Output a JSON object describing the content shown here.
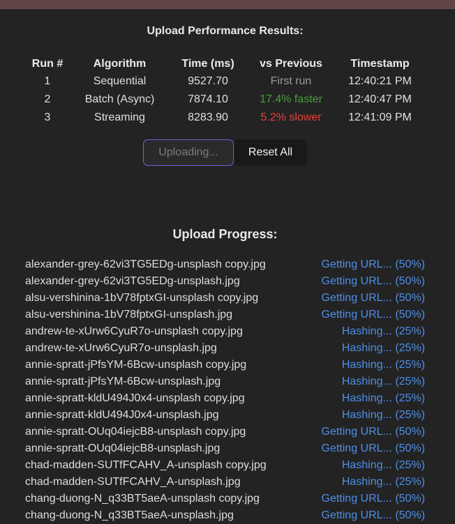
{
  "results": {
    "title": "Upload Performance Results:",
    "headers": [
      "Run #",
      "Algorithm",
      "Time (ms)",
      "vs Previous",
      "Timestamp"
    ],
    "rows": [
      {
        "run": "1",
        "algorithm": "Sequential",
        "time": "9527.70",
        "vs_previous": "First run",
        "timestamp": "12:40:21 PM"
      },
      {
        "run": "2",
        "algorithm": "Batch (Async)",
        "time": "7874.10",
        "vs_previous": "17.4% faster",
        "timestamp": "12:40:47 PM"
      },
      {
        "run": "3",
        "algorithm": "Streaming",
        "time": "8283.90",
        "vs_previous": "5.2% slower",
        "timestamp": "12:41:09 PM"
      }
    ]
  },
  "buttons": {
    "upload_label": "Uploading...",
    "reset_label": "Reset All"
  },
  "progress": {
    "title": "Upload Progress:",
    "items": [
      {
        "file": "alexander-grey-62vi3TG5EDg-unsplash copy.jpg",
        "status": "Getting URL... (50%)"
      },
      {
        "file": "alexander-grey-62vi3TG5EDg-unsplash.jpg",
        "status": "Getting URL... (50%)"
      },
      {
        "file": "alsu-vershinina-1bV78fptxGI-unsplash copy.jpg",
        "status": "Getting URL... (50%)"
      },
      {
        "file": "alsu-vershinina-1bV78fptxGI-unsplash.jpg",
        "status": "Getting URL... (50%)"
      },
      {
        "file": "andrew-te-xUrw6CyuR7o-unsplash copy.jpg",
        "status": "Hashing... (25%)"
      },
      {
        "file": "andrew-te-xUrw6CyuR7o-unsplash.jpg",
        "status": "Hashing... (25%)"
      },
      {
        "file": "annie-spratt-jPfsYM-6Bcw-unsplash copy.jpg",
        "status": "Hashing... (25%)"
      },
      {
        "file": "annie-spratt-jPfsYM-6Bcw-unsplash.jpg",
        "status": "Hashing... (25%)"
      },
      {
        "file": "annie-spratt-kldU494J0x4-unsplash copy.jpg",
        "status": "Hashing... (25%)"
      },
      {
        "file": "annie-spratt-kldU494J0x4-unsplash.jpg",
        "status": "Hashing... (25%)"
      },
      {
        "file": "annie-spratt-OUq04iejcB8-unsplash copy.jpg",
        "status": "Getting URL... (50%)"
      },
      {
        "file": "annie-spratt-OUq04iejcB8-unsplash.jpg",
        "status": "Getting URL... (50%)"
      },
      {
        "file": "chad-madden-SUTfFCAHV_A-unsplash copy.jpg",
        "status": "Hashing... (25%)"
      },
      {
        "file": "chad-madden-SUTfFCAHV_A-unsplash.jpg",
        "status": "Hashing... (25%)"
      },
      {
        "file": "chang-duong-N_q33BT5aeA-unsplash copy.jpg",
        "status": "Getting URL... (50%)"
      },
      {
        "file": "chang-duong-N_q33BT5aeA-unsplash.jpg",
        "status": "Getting URL... (50%)"
      }
    ]
  },
  "colors": {
    "background": "#232323",
    "accent_border": "#6466e0",
    "faster": "#4e9c3e",
    "slower": "#e5413a",
    "status": "#4f8fe6"
  }
}
